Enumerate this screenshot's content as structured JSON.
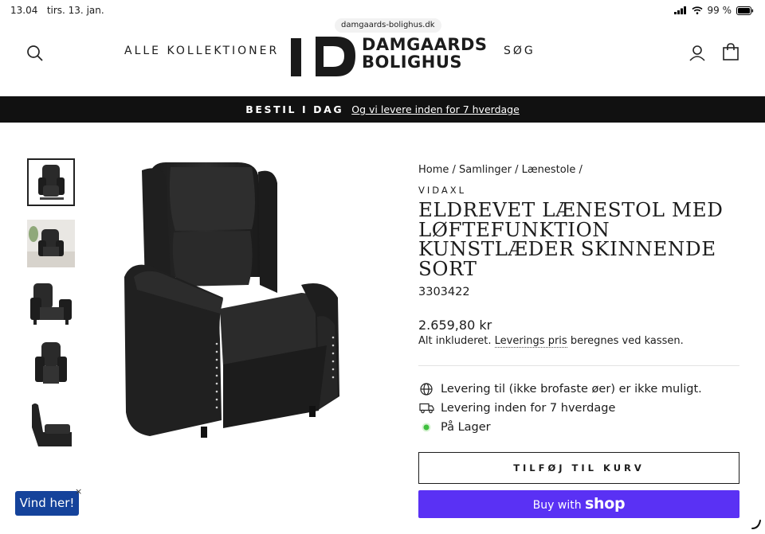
{
  "statusbar": {
    "time": "13.04",
    "date": "tirs. 13. jan.",
    "battery": "99 %"
  },
  "browser": {
    "url": "damgaards-bolighus.dk"
  },
  "header": {
    "nav_collections": "ALLE KOLLEKTIONER",
    "nav_search": "SØG",
    "logo_line1": "DAMGAARDS",
    "logo_line2": "BOLIGHUS",
    "logo_mark": "D"
  },
  "banner": {
    "bold": "BESTIL I DAG",
    "link": "Og vi levere inden for 7 hverdage"
  },
  "breadcrumb": {
    "home": "Home",
    "sep": " / ",
    "collections": "Samlinger",
    "category": "Lænestole",
    "trail": " /"
  },
  "product": {
    "vendor": "VIDAXL",
    "title": "ELDREVET LÆNESTOL MED LØFTEFUNKTION KUNSTLÆDER SKINNENDE SORT",
    "sku": "3303422",
    "price": "2.659,80 kr",
    "tax_prefix": "Alt inkluderet. ",
    "tax_link": "Leverings pris",
    "tax_suffix": " beregnes ved kassen."
  },
  "features": [
    {
      "icon": "globe-icon",
      "text": "Levering til (ikke brofaste øer) er ikke muligt."
    },
    {
      "icon": "truck-icon",
      "text": "Levering inden for 7 hverdage"
    },
    {
      "icon": "in-stock-dot-icon",
      "text": "På Lager"
    }
  ],
  "buttons": {
    "add_to_cart": "TILFØJ TIL KURV",
    "buy_with": "Buy with",
    "shop": "shop"
  },
  "widget": {
    "vind": "Vind her!",
    "close": "×"
  },
  "colors": {
    "shop_pay": "#5a31f4",
    "vind_bg": "#15439b",
    "in_stock": "#3fbf3f",
    "banner_bg": "#111111"
  }
}
